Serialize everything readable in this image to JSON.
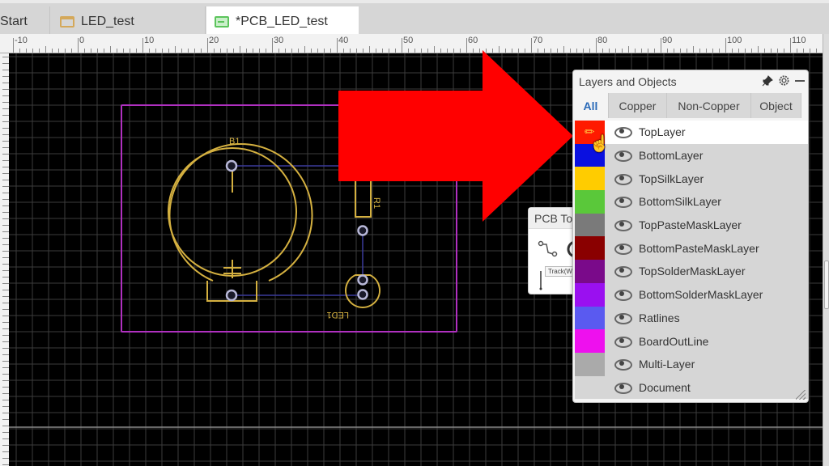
{
  "tabs": [
    {
      "label": "Start",
      "icon": "none",
      "active": false
    },
    {
      "label": "LED_test",
      "icon": "folder-icon",
      "active": false
    },
    {
      "label": "*PCB_LED_test",
      "icon": "pcb-document-icon",
      "active": true
    }
  ],
  "ruler": {
    "labels": [
      "-10",
      "0",
      "10",
      "20",
      "30",
      "40",
      "50",
      "60",
      "70",
      "80",
      "90",
      "100",
      "110"
    ]
  },
  "pcb": {
    "components": [
      {
        "designator": "B1",
        "type": "coin-cell-battery-holder"
      },
      {
        "designator": "R1",
        "type": "resistor"
      },
      {
        "designator": "LED1",
        "type": "led"
      }
    ],
    "colors": {
      "board_outline": "#b030c0",
      "silk": "#d4b040",
      "track": "#3a3a9a",
      "pad": "#b8b8d8",
      "grid": "#3c3c3c"
    }
  },
  "pcb_tools": {
    "title": "PCB To",
    "tooltip": "Track(W)"
  },
  "annotation": {
    "arrow_color": "#ff0000",
    "arrow_direction": "right"
  },
  "layers_panel": {
    "title": "Layers and Objects",
    "tabs": [
      {
        "label": "All",
        "active": true
      },
      {
        "label": "Copper",
        "active": false
      },
      {
        "label": "Non-Copper",
        "active": false
      },
      {
        "label": "Object",
        "active": false
      }
    ],
    "layers": [
      {
        "name": "TopLayer",
        "color": "#ff1a00",
        "visible": true,
        "selected": true,
        "editing": true
      },
      {
        "name": "BottomLayer",
        "color": "#0a10e0",
        "visible": true
      },
      {
        "name": "TopSilkLayer",
        "color": "#ffcc00",
        "visible": true
      },
      {
        "name": "BottomSilkLayer",
        "color": "#5ac83a",
        "visible": true
      },
      {
        "name": "TopPasteMaskLayer",
        "color": "#7a7a7a",
        "visible": true
      },
      {
        "name": "BottomPasteMaskLayer",
        "color": "#8a0000",
        "visible": true
      },
      {
        "name": "TopSolderMaskLayer",
        "color": "#7a0a8a",
        "visible": true
      },
      {
        "name": "BottomSolderMaskLayer",
        "color": "#9a10f0",
        "visible": true
      },
      {
        "name": "Ratlines",
        "color": "#5a5af0",
        "visible": true
      },
      {
        "name": "BoardOutLine",
        "color": "#ee10ee",
        "visible": true
      },
      {
        "name": "Multi-Layer",
        "color": "#aaaaaa",
        "visible": true
      },
      {
        "name": "Document",
        "color": "#d6d6d6",
        "visible": true
      }
    ]
  }
}
